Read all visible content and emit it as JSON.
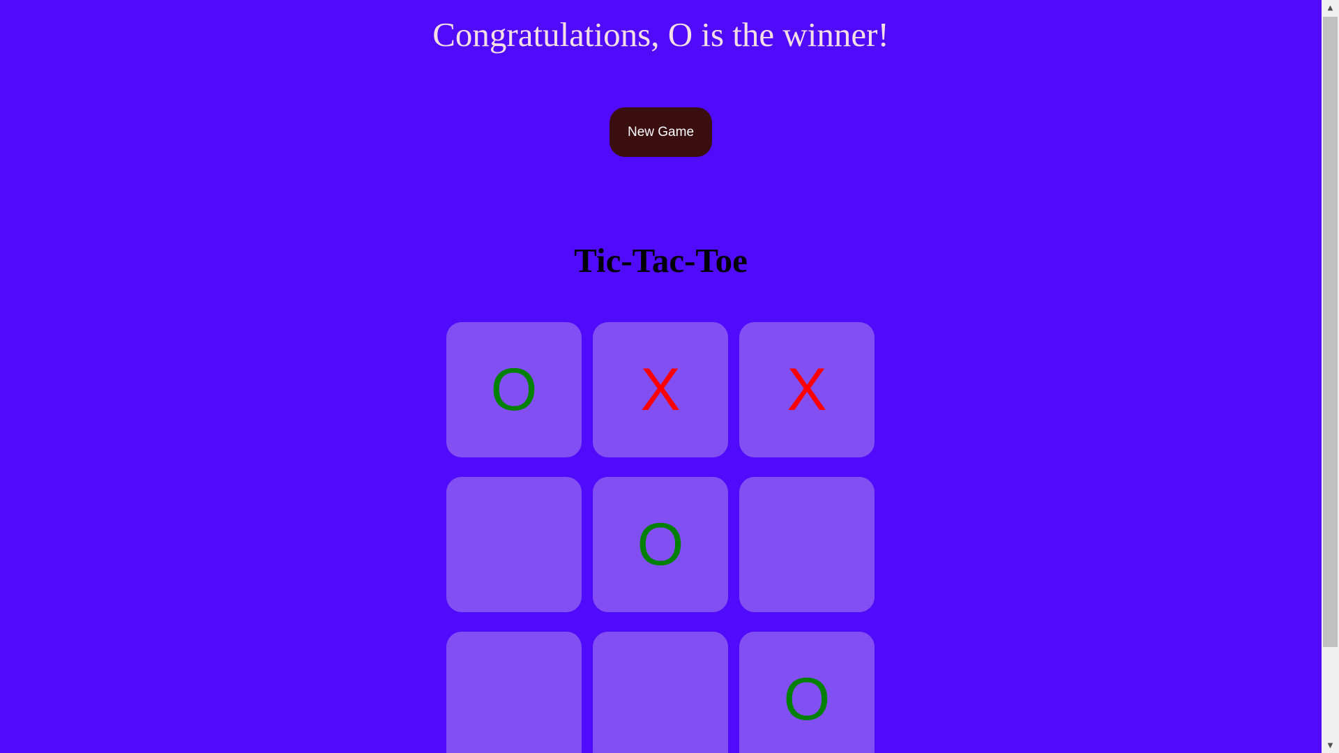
{
  "status": {
    "message": "Congratulations, O is the winner!"
  },
  "controls": {
    "new_game_label": "New Game"
  },
  "game": {
    "title": "Tic-Tac-Toe"
  },
  "board": {
    "cells": [
      "O",
      "X",
      "X",
      "",
      "O",
      "",
      "",
      "",
      "O"
    ]
  },
  "colors": {
    "background": "#500bfa",
    "cell": "#8250f2",
    "mark_O": "#008000",
    "mark_X": "#ff0000",
    "button": "#3a0e0e",
    "message_text": "#f5dfe6"
  },
  "icons": {
    "scroll_up": "triangle-up-icon",
    "scroll_down": "triangle-down-icon"
  }
}
